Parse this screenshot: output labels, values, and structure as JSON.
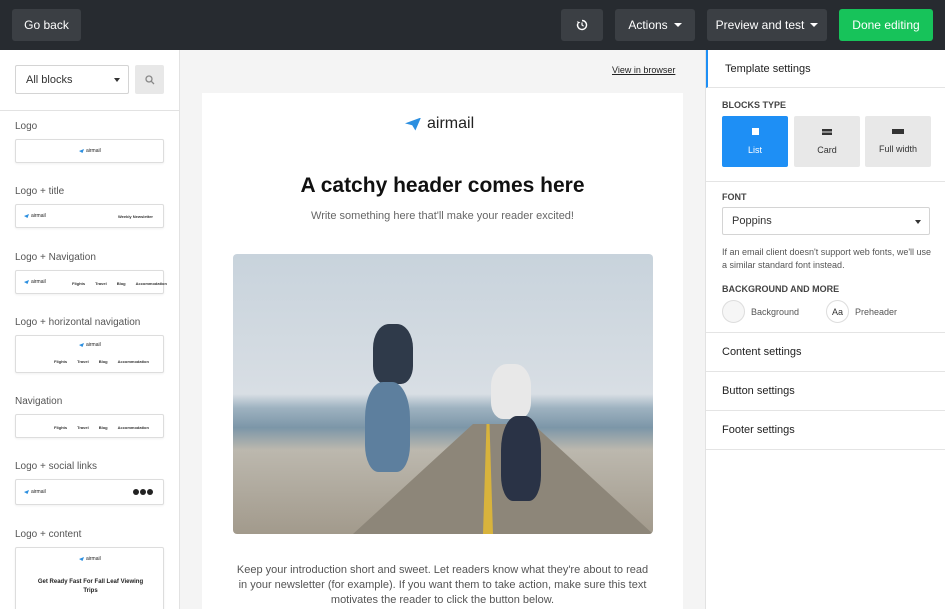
{
  "topbar": {
    "go_back": "Go back",
    "actions": "Actions",
    "preview": "Preview and test",
    "done": "Done editing",
    "history_icon": "history-icon"
  },
  "left": {
    "filter": "All blocks",
    "search_icon": "search-icon",
    "blocks": [
      {
        "label": "Logo"
      },
      {
        "label": "Logo + title",
        "title": "Weekly Newsletter"
      },
      {
        "label": "Logo + Navigation"
      },
      {
        "label": "Logo + horizontal navigation"
      },
      {
        "label": "Navigation"
      },
      {
        "label": "Logo + social links"
      },
      {
        "label": "Logo + content",
        "content_title": "Get Ready Fast For Fall Leaf Viewing Trips"
      }
    ],
    "brand": "airmail",
    "nav_items": [
      "Flights",
      "Travel",
      "Blog",
      "Accommodation"
    ]
  },
  "canvas": {
    "view_in_browser": "View in browser",
    "brand": "airmail",
    "headline": "A catchy header comes here",
    "subline": "Write something here that'll make your reader excited!",
    "intro": "Keep your introduction short and sweet. Let readers know what they're about to read in your newsletter (for example). If you want them to take action, make sure this text motivates the reader to click the button below."
  },
  "right": {
    "title": "Template settings",
    "blocks_type_label": "BLOCKS TYPE",
    "types": [
      "List",
      "Card",
      "Full width"
    ],
    "font_label": "FONT",
    "font_value": "Poppins",
    "font_note": "If an email client doesn't support web fonts, we'll use a similar standard font instead.",
    "bg_label": "BACKGROUND AND MORE",
    "background": "Background",
    "preheader": "Preheader",
    "preheader_glyph": "Aa",
    "sections": [
      "Content settings",
      "Button settings",
      "Footer settings"
    ]
  },
  "colors": {
    "topbar": "#272b30",
    "accent": "#1e8ff5",
    "done": "#17c35a"
  }
}
